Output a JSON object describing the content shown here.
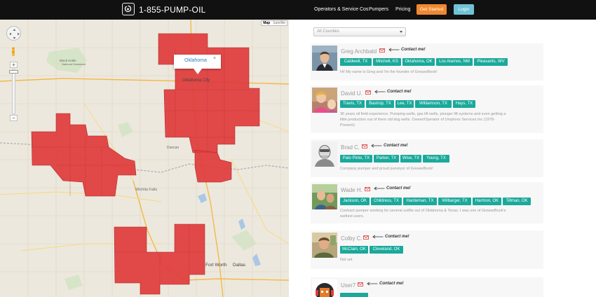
{
  "nav": {
    "phone": "1-855-PUMP-OIL",
    "links": [
      "Operators & Service Cos",
      "Pumpers",
      "Pricing"
    ],
    "get_started": "Get Started",
    "login": "Login",
    "logo_icon": "oil-drop-icon",
    "colors": {
      "bg": "#111111",
      "get_started": "#f0882f",
      "login": "#6fc3d6"
    }
  },
  "map": {
    "type_buttons": [
      "Map",
      "Satellite"
    ],
    "active_type": "Map",
    "zoom_in": "+",
    "zoom_out": "−",
    "info_window": {
      "label": "Oklahoma",
      "close": "×"
    },
    "region_color": "#e03b3b",
    "cities": [
      "Black Kettle",
      "Oklahoma City",
      "Duncan",
      "Wichita Falls",
      "Fort Worth",
      "Dallas"
    ]
  },
  "filter": {
    "value": "All Counties"
  },
  "pumpers": [
    {
      "name": "Greg Archbald",
      "contact": "Contact me!",
      "counties": [
        "Caldwell, TX",
        "Mitchell, KS",
        "Oklahoma, OK",
        "Los Alamos, NM",
        "Pleasants, WV"
      ],
      "bio": [
        "Hi! My name is Greg and I'm the founder of GreaseBook!"
      ]
    },
    {
      "name": "David U.",
      "contact": "Contact me!",
      "counties": [
        "Travis, TX",
        "Bastrop, TX",
        "Lee, TX",
        "Williamson, TX",
        "Hays, TX"
      ],
      "bio": [
        "36 years oil field experience. Pumping wells, gas lift wells, plunger lift systems and even getting a",
        "little production out of them old dog wells. Owner/Operator of Umphres Services Inc (1978-",
        "Present)"
      ]
    },
    {
      "name": "Brad C.",
      "contact": "Contact me!",
      "counties": [
        "Palo Pinto, TX",
        "Parker, TX",
        "Wise, TX",
        "Young, TX"
      ],
      "bio": [
        "Company pumper and proud purveyor of GreaseBook!"
      ]
    },
    {
      "name": "Wade H.",
      "contact": "Contact me!",
      "counties": [
        "Jackson, OK",
        "Childress, TX",
        "Hardeman, TX",
        "Wilbarger, TX",
        "Harmon, OK",
        "Tillman, OK"
      ],
      "bio": [
        "Contract pumper working for several outfits out of Oklahoma & Texas. I was one of GreaseBook's",
        "earliest users."
      ]
    },
    {
      "name": "Colby C.",
      "contact": "Contact me!",
      "counties": [
        "McClain, OK",
        "Cleveland, OK"
      ],
      "bio": [
        "Not set"
      ]
    },
    {
      "name": "User7",
      "contact": "Contact me!",
      "counties": [],
      "bio": []
    }
  ]
}
